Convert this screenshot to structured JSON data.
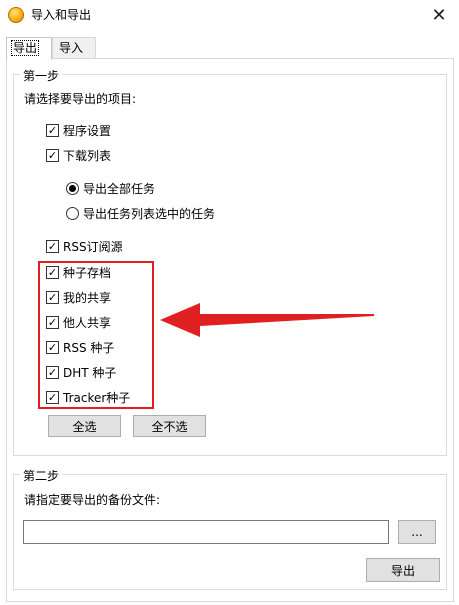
{
  "window": {
    "title": "导入和导出",
    "close_glyph": "✕"
  },
  "tabs": [
    {
      "label": "导出",
      "active": true
    },
    {
      "label": "导入",
      "active": false
    }
  ],
  "step1": {
    "legend": "第一步",
    "instruction": "请选择要导出的项目:",
    "items": {
      "program_settings": {
        "label": "程序设置",
        "checked": true
      },
      "download_list": {
        "label": "下载列表",
        "checked": true
      },
      "export_all_tasks": {
        "label": "导出全部任务",
        "selected": true
      },
      "export_selected_tasks": {
        "label": "导出任务列表选中的任务",
        "selected": false
      },
      "rss_subscriptions": {
        "label": "RSS订阅源",
        "checked": true
      },
      "seed_archive": {
        "label": "种子存档",
        "checked": true
      },
      "my_shares": {
        "label": "我的共享",
        "checked": true
      },
      "others_shares": {
        "label": "他人共享",
        "checked": true
      },
      "rss_seeds": {
        "label": "RSS 种子",
        "checked": true
      },
      "dht_seeds": {
        "label": "DHT 种子",
        "checked": true
      },
      "tracker_seeds": {
        "label": "Tracker种子",
        "checked": true
      }
    },
    "check_glyph": "✓",
    "select_all_label": "全选",
    "select_none_label": "全不选"
  },
  "step2": {
    "legend": "第二步",
    "instruction": "请指定要导出的备份文件:",
    "file_path_value": "",
    "browse_label": "...",
    "export_label": "导出"
  },
  "annotation": {
    "highlight_color": "#e02020"
  }
}
